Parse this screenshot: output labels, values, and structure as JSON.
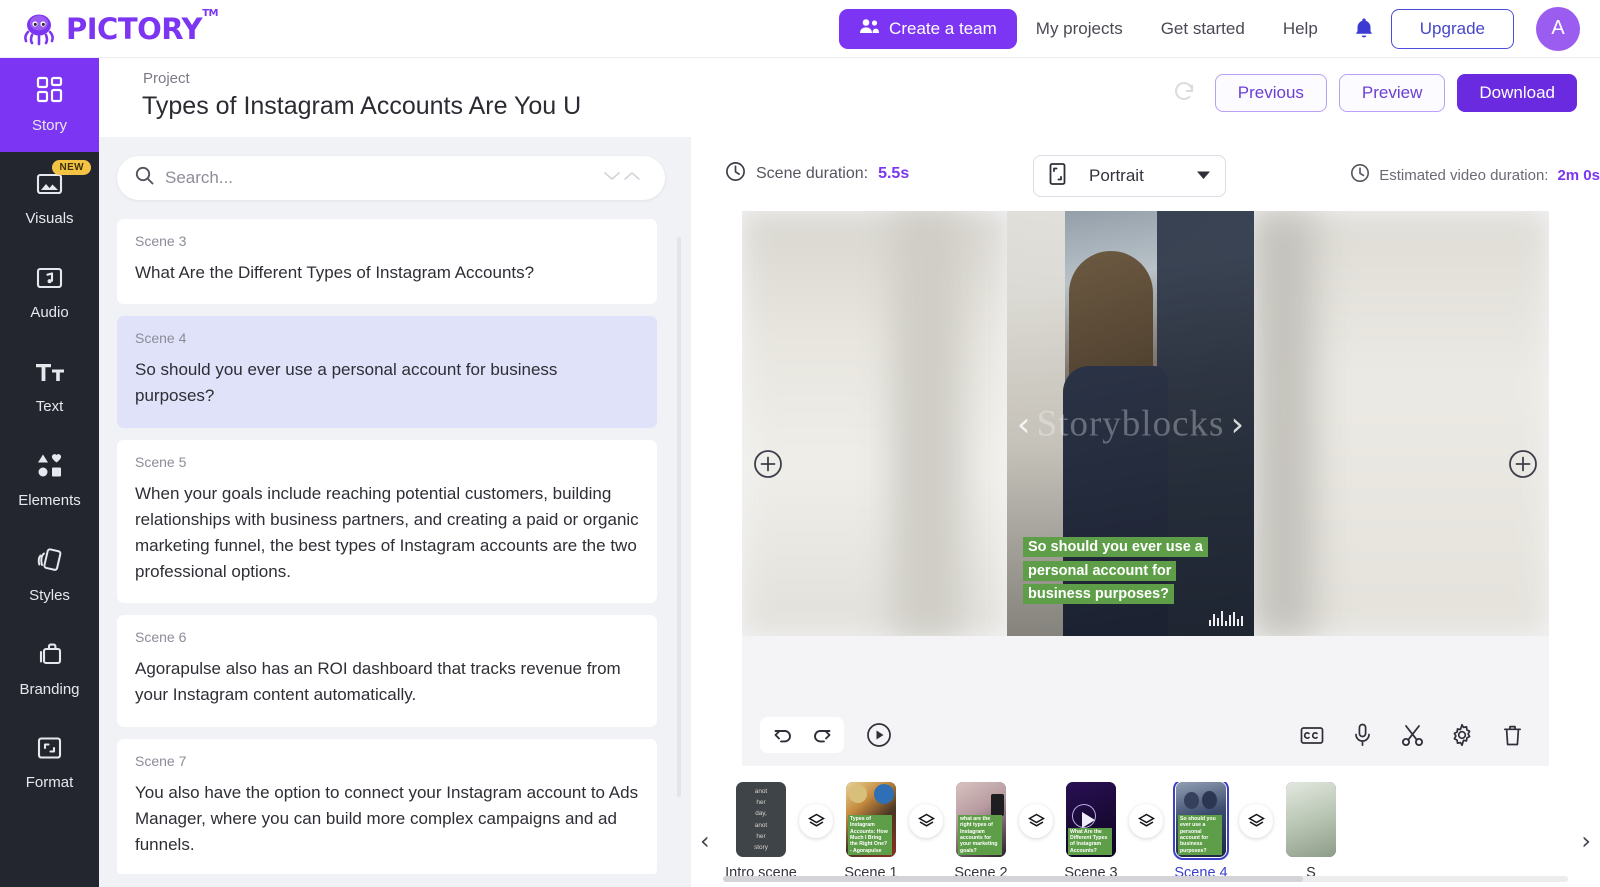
{
  "header": {
    "brand": "PICTORY",
    "brand_tm": "TM",
    "create_team": "Create a team",
    "nav": [
      {
        "label": "My projects"
      },
      {
        "label": "Get started"
      },
      {
        "label": "Help"
      }
    ],
    "bell_icon": "bell-icon",
    "upgrade": "Upgrade",
    "avatar_initial": "A",
    "brand_color": "#7c35f2"
  },
  "sidebar": {
    "items": [
      {
        "label": "Story",
        "icon": "grid-icon",
        "active": true,
        "badge": ""
      },
      {
        "label": "Visuals",
        "icon": "image-icon",
        "active": false,
        "badge": "NEW"
      },
      {
        "label": "Audio",
        "icon": "music-icon",
        "active": false,
        "badge": ""
      },
      {
        "label": "Text",
        "icon": "text-icon",
        "active": false,
        "badge": ""
      },
      {
        "label": "Elements",
        "icon": "shapes-icon",
        "active": false,
        "badge": ""
      },
      {
        "label": "Styles",
        "icon": "styles-icon",
        "active": false,
        "badge": ""
      },
      {
        "label": "Branding",
        "icon": "briefcase-icon",
        "active": false,
        "badge": ""
      },
      {
        "label": "Format",
        "icon": "crop-icon",
        "active": false,
        "badge": ""
      }
    ]
  },
  "project": {
    "label": "Project",
    "title": "Types of Instagram Accounts Are You U",
    "refresh_icon": "refresh-icon",
    "previous": "Previous",
    "preview": "Preview",
    "download": "Download"
  },
  "script_panel": {
    "search_placeholder": "Search...",
    "search_icon": "search-icon",
    "scenes": [
      {
        "num": "Scene 3",
        "text": "What Are the Different Types of Instagram Accounts?",
        "selected": false
      },
      {
        "num": "Scene 4",
        "text": "So should you ever use a personal account for business purposes?",
        "selected": true
      },
      {
        "num": "Scene 5",
        "text": "When your goals include reaching potential customers, building relationships with business partners, and creating a paid or organic marketing funnel, the best types of Instagram accounts are the two professional options.",
        "selected": false
      },
      {
        "num": "Scene 6",
        "text": "Agorapulse also has an ROI dashboard that tracks revenue from your Instagram content automatically.",
        "selected": false
      },
      {
        "num": "Scene 7",
        "text": "You also have the option to connect your Instagram account to Ads Manager, where you can build more complex campaigns and ad funnels.",
        "selected": false
      }
    ]
  },
  "preview": {
    "scene_duration_label": "Scene duration:",
    "scene_duration_value": "5.5s",
    "clock_icon": "clock-icon",
    "format_label": "Portrait",
    "format_icon": "portrait-icon",
    "chevron_icon": "chevron-down-icon",
    "estimated_label": "Estimated video duration:",
    "estimated_value": "2m 0s",
    "watermark": "Storyblocks",
    "caption_lines": [
      "So should you ever use a",
      "personal account for",
      "business purposes?"
    ],
    "caption_bg": "#5f9e48",
    "prev_arrow": "‹",
    "next_arrow": "›",
    "add_left_icon": "add-scene-left-icon",
    "add_right_icon": "add-scene-right-icon",
    "controls": {
      "undo": "undo-icon",
      "redo": "redo-icon",
      "play": "play-icon",
      "captions": "closed-captions-icon",
      "voiceover": "microphone-icon",
      "trim": "scissors-icon",
      "settings": "gear-icon",
      "delete": "trash-icon"
    }
  },
  "timeline": {
    "left_arrow": "‹",
    "right_arrow": "›",
    "scenes": [
      {
        "label": "Intro scene",
        "selected": false,
        "hidden": true,
        "caption": "anot her day, anot her story",
        "bg": "#3f4449"
      },
      {
        "label": "Scene 1",
        "selected": false,
        "hidden": false,
        "caption": "Types of Instagram Accounts: How Much I Bring the Right One? - Agorapulse",
        "bg": "#b8793f"
      },
      {
        "label": "Scene 2",
        "selected": false,
        "hidden": false,
        "caption": "what are the right types of Instagram accounts for your marketing goals?",
        "bg": "#c8a2a8"
      },
      {
        "label": "Scene 3",
        "selected": false,
        "hidden": false,
        "caption": "What Are the Different Types of Instagram Accounts?",
        "bg": "#1c0b3a"
      },
      {
        "label": "Scene 4",
        "selected": true,
        "hidden": false,
        "caption": "So should you ever use a personal account for business purposes?",
        "bg": "#2f3f6b"
      },
      {
        "label": "S",
        "selected": false,
        "hidden": false,
        "caption": "",
        "bg": "#c9d4c6"
      }
    ],
    "transition_icon": "transition-layers-icon",
    "eye_off_icon": "eye-off-icon"
  }
}
